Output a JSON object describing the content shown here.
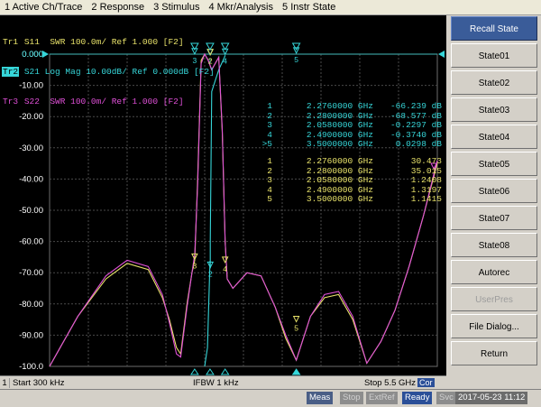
{
  "menu": {
    "items": [
      "1 Active Ch/Trace",
      "2 Response",
      "3 Stimulus",
      "4 Mkr/Analysis",
      "5 Instr State"
    ]
  },
  "traces": [
    {
      "tag": "Tr1",
      "label": "S11  SWR 100.0m/ Ref 1.000 [F2]",
      "color": "#e9e36a"
    },
    {
      "tag": "Tr2",
      "label": "S21 Log Mag 10.00dB/ Ref 0.000dB [F2]",
      "color": "#36d6d9"
    },
    {
      "tag": "Tr3",
      "label": "S22  SWR 100.0m/ Ref 1.000 [F2]",
      "color": "#e050d8"
    }
  ],
  "chart_data": {
    "type": "line",
    "title": "",
    "xlabel": "",
    "ylabel": "",
    "xlim": [
      0.0003,
      5.5
    ],
    "ylim": [
      -100,
      0
    ],
    "grid": true,
    "y_ticks": [
      "0.000",
      "-10.00",
      "-20.00",
      "-30.00",
      "-40.00",
      "-50.00",
      "-60.00",
      "-70.00",
      "-80.00",
      "-90.00",
      "-100.0"
    ],
    "series": [
      {
        "name": "S11",
        "color": "#e9e36a",
        "x": [
          0.0003,
          0.15,
          0.4,
          0.8,
          1.1,
          1.4,
          1.6,
          1.7,
          1.8,
          1.86,
          1.95,
          2.02,
          2.06,
          2.1,
          2.15,
          2.2,
          2.25,
          2.3,
          2.35,
          2.4,
          2.45,
          2.49,
          2.52,
          2.6,
          2.8,
          3.0,
          3.2,
          3.35,
          3.5,
          3.7,
          3.9,
          4.1,
          4.3,
          4.5,
          4.7,
          4.9,
          5.1,
          5.3,
          5.5
        ],
        "y": [
          -100,
          -94,
          -84,
          -72,
          -67,
          -69,
          -78,
          -85,
          -94,
          -96,
          -80,
          -70,
          -66,
          -40,
          -2,
          0,
          -2,
          -5,
          -3,
          -1,
          -25,
          -60,
          -72,
          -75,
          -70,
          -71,
          -81,
          -91,
          -98,
          -84,
          -78,
          -77,
          -85,
          -99,
          -92,
          -82,
          -68,
          -52,
          -35
        ]
      },
      {
        "name": "S21",
        "color": "#36d6d9",
        "x": [
          2.2,
          2.24,
          2.276,
          2.28,
          2.28,
          2.3,
          2.4,
          2.48,
          2.49
        ],
        "y": [
          -100,
          -94,
          -66.2,
          -68.6,
          -60,
          -12,
          -5,
          -1,
          -0.37
        ]
      },
      {
        "name": "S22",
        "color": "#e050d8",
        "x": [
          0.0003,
          0.15,
          0.4,
          0.8,
          1.1,
          1.4,
          1.6,
          1.7,
          1.8,
          1.86,
          1.95,
          2.02,
          2.06,
          2.1,
          2.15,
          2.2,
          2.25,
          2.3,
          2.35,
          2.4,
          2.45,
          2.49,
          2.52,
          2.6,
          2.8,
          3.0,
          3.2,
          3.35,
          3.5,
          3.7,
          3.9,
          4.1,
          4.3,
          4.5,
          4.7,
          4.9,
          5.1,
          5.3,
          5.5
        ],
        "y": [
          -100,
          -94,
          -84,
          -71,
          -66,
          -68,
          -77,
          -86,
          -96,
          -97,
          -81,
          -70,
          -64,
          -42,
          -3,
          0,
          -2,
          -5,
          -3,
          -1,
          -24,
          -60,
          -72,
          -75,
          -70,
          -71,
          -81,
          -90,
          -98,
          -84,
          -77,
          -76,
          -84,
          -99,
          -92,
          -82,
          -68,
          -52,
          -34
        ]
      }
    ],
    "ref_marker_value": "0.000",
    "markers_s21": [
      {
        "id": "1",
        "freq": "2.2760000 GHz",
        "value": "-66.239 dB"
      },
      {
        "id": "2",
        "freq": "2.2800000 GHz",
        "value": "-68.577 dB"
      },
      {
        "id": "3",
        "freq": "2.0580000 GHz",
        "value": "-0.2297 dB"
      },
      {
        "id": "4",
        "freq": "2.4900000 GHz",
        "value": "-0.3740 dB"
      },
      {
        "id": ">5",
        "freq": "3.5000000 GHz",
        "value": "0.0298 dB"
      }
    ],
    "markers_swr": [
      {
        "id": "1",
        "freq": "2.2760000 GHz",
        "value": "30.473"
      },
      {
        "id": "2",
        "freq": "2.2800000 GHz",
        "value": "35.015"
      },
      {
        "id": "3",
        "freq": "2.0580000 GHz",
        "value": "1.2408"
      },
      {
        "id": "4",
        "freq": "2.4900000 GHz",
        "value": "1.3197"
      },
      {
        "id": "5",
        "freq": "3.5000000 GHz",
        "value": "1.1415"
      }
    ],
    "marker_flags": [
      {
        "id": "3",
        "x": 2.058,
        "y": -0.23,
        "color": "#36d6d9"
      },
      {
        "id": "1",
        "x": 2.276,
        "y": -0.5,
        "color": "#36d6d9"
      },
      {
        "id": "2",
        "x": 2.28,
        "y": -0.5,
        "color": "#e9e36a"
      },
      {
        "id": "4",
        "x": 2.49,
        "y": -0.37,
        "color": "#36d6d9"
      },
      {
        "id": "5",
        "x": 3.5,
        "y": 0.03,
        "color": "#36d6d9"
      },
      {
        "id": "2",
        "x": 2.28,
        "y": -68.6,
        "color": "#36d6d9"
      },
      {
        "id": "3",
        "x": 2.058,
        "y": -66,
        "color": "#e9e36a"
      },
      {
        "id": "4",
        "x": 2.49,
        "y": -67,
        "color": "#e9e36a"
      },
      {
        "id": "5",
        "x": 3.5,
        "y": -86,
        "color": "#e9e36a"
      },
      {
        "id": "1",
        "x": 5.45,
        "y": -37,
        "color": "#e050d8"
      }
    ]
  },
  "status": {
    "channel": "1",
    "start": "Start 300 kHz",
    "ifbw": "IFBW 1 kHz",
    "stop": "Stop 5.5 GHz",
    "cor": "Cor"
  },
  "bottom": {
    "meas": "Meas",
    "stop": "Stop",
    "extref": "ExtRef",
    "ready": "Ready",
    "svc": "Svc",
    "datetime": "2017-05-23 11:12"
  },
  "softkeys": {
    "title": "Recall State",
    "items": [
      "State01",
      "State02",
      "State03",
      "State04",
      "State05",
      "State06",
      "State07",
      "State08",
      "Autorec",
      "UserPres",
      "File Dialog...",
      "Return"
    ],
    "disabled": [
      "UserPres"
    ]
  }
}
